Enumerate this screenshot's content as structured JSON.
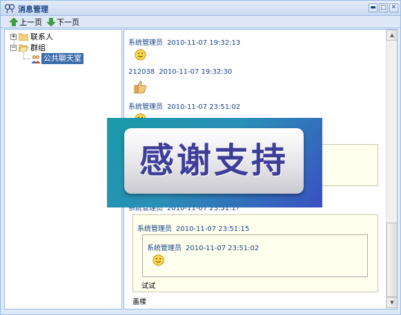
{
  "window": {
    "title": "消息管理"
  },
  "toolbar": {
    "prev_label": "上一页",
    "next_label": "下一页"
  },
  "tree": {
    "nodes": [
      {
        "label": "联系人",
        "expander": "+"
      },
      {
        "label": "群组",
        "expander": "−"
      },
      {
        "label": "公共聊天室",
        "selected": true
      }
    ]
  },
  "messages": [
    {
      "sender": "系统管理员",
      "time": "2010-11-07 19:32:13",
      "content": "smiley-icon"
    },
    {
      "sender": "212038",
      "time": "2010-11-07 19:32:30",
      "content": "thumbs-up-icon"
    },
    {
      "sender": "系统管理员",
      "time": "2010-11-07 23:51:02",
      "content": "smiley-icon"
    },
    {
      "sender": "系统管理员",
      "time": "2010-11-07 23:51:1?",
      "content": "quote"
    }
  ],
  "reply": {
    "outer_sender": "系统管理员",
    "outer_time": "2010-11-07 23:51:15",
    "inner_sender": "系统管理员",
    "inner_time": "2010-11-07 23:51:02",
    "outer_text": "试试",
    "after_text": "盖楼"
  },
  "overlay": {
    "text": "感谢支持"
  },
  "colors": {
    "header_bg": "#c9d9ef",
    "border": "#99bbe8",
    "link_text": "#15428b",
    "selected_bg": "#3b6dab",
    "quote_bg": "#ffffee",
    "overlay_text": "#3e3e9a"
  }
}
